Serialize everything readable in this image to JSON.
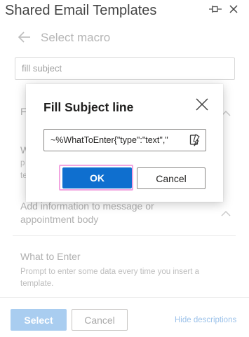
{
  "pane": {
    "title": "Shared Email Templates"
  },
  "nav": {
    "title": "Select macro"
  },
  "search": {
    "value": "fill subject"
  },
  "macros": [
    {
      "title_fragment": "F",
      "desc_fragments": [
        "W",
        "p",
        "te"
      ]
    },
    {
      "title_line1": "Add information to message or",
      "title_line2": "appointment body"
    },
    {
      "title": "What to Enter",
      "desc_line1": "Prompt to enter some data every time you insert a",
      "desc_line2": "template."
    }
  ],
  "dialog": {
    "title": "Fill Subject line",
    "field_value": "~%WhatToEnter{\"type\":\"text\",\"",
    "ok_label": "OK",
    "cancel_label": "Cancel"
  },
  "footer": {
    "select_label": "Select",
    "cancel_label": "Cancel",
    "hide_link": "Hide descriptions"
  },
  "colors": {
    "accent": "#0f6fcf",
    "accent_disabled": "#a9cdf0",
    "focus_ring": "#f2a5e0"
  }
}
